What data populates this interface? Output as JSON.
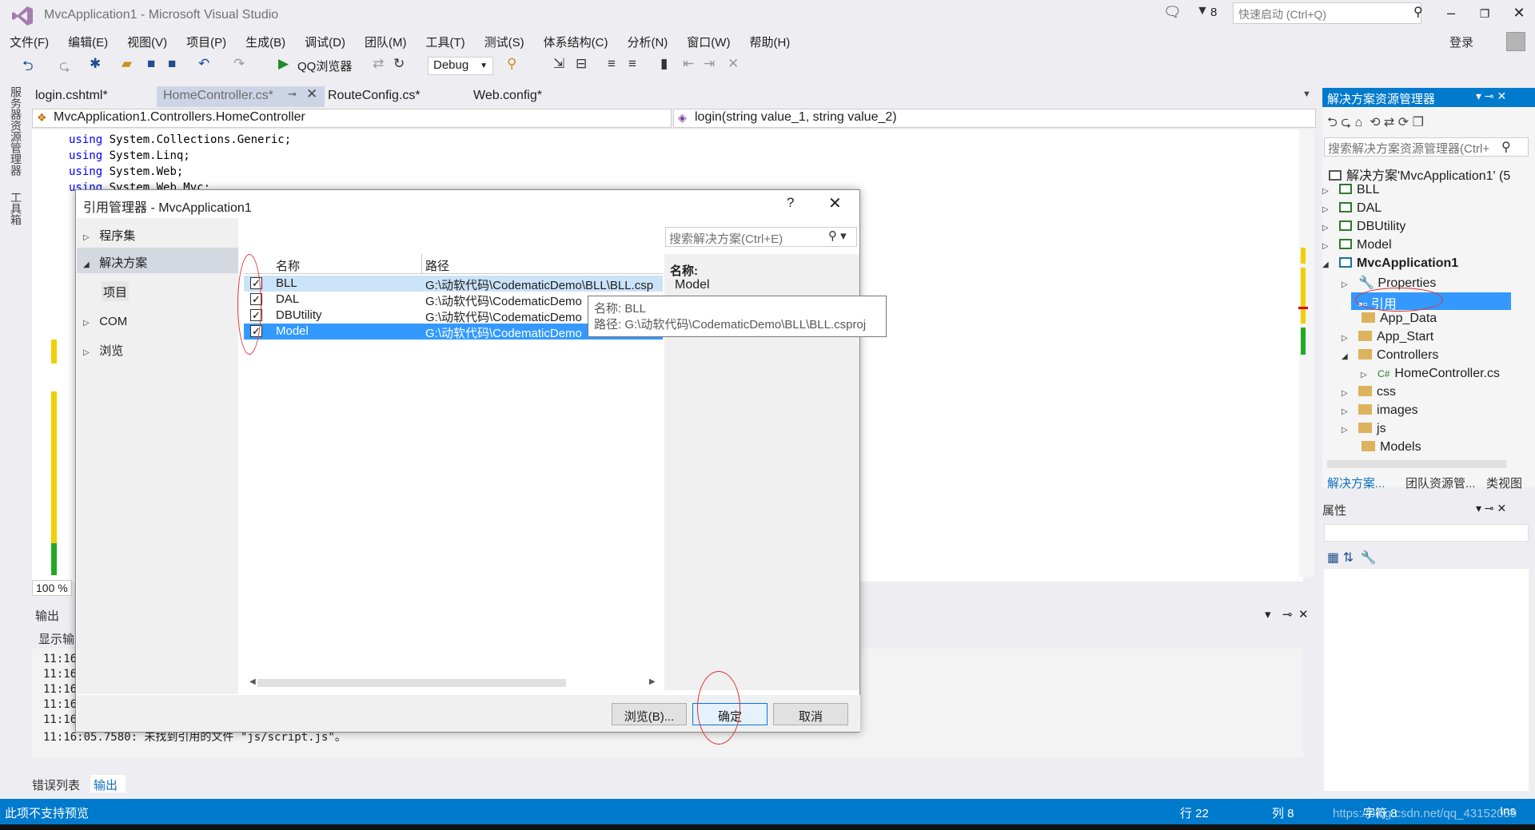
{
  "window": {
    "title": "MvcApplication1 - Microsoft Visual Studio",
    "quick_launch_placeholder": "快速启动 (Ctrl+Q)",
    "notification_count": "8",
    "login": "登录"
  },
  "menu": [
    "文件(F)",
    "编辑(E)",
    "视图(V)",
    "项目(P)",
    "生成(B)",
    "调试(D)",
    "团队(M)",
    "工具(T)",
    "测试(S)",
    "体系结构(C)",
    "分析(N)",
    "窗口(W)",
    "帮助(H)"
  ],
  "toolbar": {
    "browser": "QQ浏览器",
    "config": "Debug"
  },
  "left_strip": {
    "server_explorer": "服务器资源管理器",
    "toolbox": "工具箱"
  },
  "tabs": {
    "login": "login.cshtml*",
    "home": "HomeController.cs*",
    "route": "RouteConfig.cs*",
    "web": "Web.config*"
  },
  "navbar": {
    "class": "MvcApplication1.Controllers.HomeController",
    "method": "login(string value_1, string value_2)"
  },
  "code": {
    "line1_kw": "using",
    "line1": " System.Collections.Generic;",
    "line2_kw": "using",
    "line2": " System.Linq;",
    "line3_kw": "using",
    "line3": " System.Web;",
    "line4_kw": "using",
    "line4": " System.Web.Mvc;"
  },
  "editor": {
    "zoom": "100 %"
  },
  "output": {
    "title": "输出",
    "show_from": "显示输",
    "lines": [
      "11:16",
      "11:16",
      "11:16",
      "11:16",
      "11:16",
      "11:16:05.7580: 未找到引用的文件 \"js/script.js\"。"
    ]
  },
  "bottom_tabs": {
    "errors": "错误列表",
    "output": "输出"
  },
  "status": {
    "message": "此项不支持预览",
    "row": "行 22",
    "col": "列 8",
    "char": "字符 8",
    "ins": "Ins",
    "watermark": "https://blog.csdn.net/qq_43152059"
  },
  "solution_explorer": {
    "title": "解决方案资源管理器",
    "search_placeholder": "搜索解决方案资源管理器(Ctrl+",
    "solution": "解决方案'MvcApplication1' (5",
    "items": {
      "bll": "BLL",
      "dal": "DAL",
      "dbutility": "DBUtility",
      "model": "Model",
      "mvc": "MvcApplication1",
      "properties": "Properties",
      "references": "引用",
      "app_data": "App_Data",
      "app_start": "App_Start",
      "controllers": "Controllers",
      "homecontroller": "HomeController.cs",
      "css": "css",
      "images": "images",
      "js": "js",
      "models": "Models"
    },
    "tab_active": "解决方案...",
    "tab_team": "团队资源管...",
    "tab_class": "类视图"
  },
  "properties": {
    "title": "属性"
  },
  "dialog": {
    "title": "引用管理器 - MvcApplication1",
    "help": "?",
    "nav": {
      "assemblies": "程序集",
      "solution": "解决方案",
      "projects": "项目",
      "com": "COM",
      "browse": "浏览"
    },
    "search_placeholder": "搜索解决方案(Ctrl+E)",
    "columns": {
      "name": "名称",
      "path": "路径"
    },
    "rows": [
      {
        "name": "BLL",
        "path": "G:\\动软代码\\CodematicDemo\\BLL\\BLL.csp",
        "checked": true
      },
      {
        "name": "DAL",
        "path": "G:\\动软代码\\CodematicDemo",
        "checked": true
      },
      {
        "name": "DBUtility",
        "path": "G:\\动软代码\\CodematicDemo",
        "checked": true
      },
      {
        "name": "Model",
        "path": "G:\\动软代码\\CodematicDemo",
        "checked": true
      }
    ],
    "detail": {
      "label": "名称:",
      "value": "Model"
    },
    "tooltip": {
      "name": "名称: BLL",
      "path": "路径: G:\\动软代码\\CodematicDemo\\BLL\\BLL.csproj"
    },
    "buttons": {
      "browse": "浏览(B)...",
      "ok": "确定",
      "cancel": "取消"
    }
  },
  "colors": {
    "accent": "#007acc",
    "selection": "#3399ff",
    "annotation": "#e03030"
  }
}
